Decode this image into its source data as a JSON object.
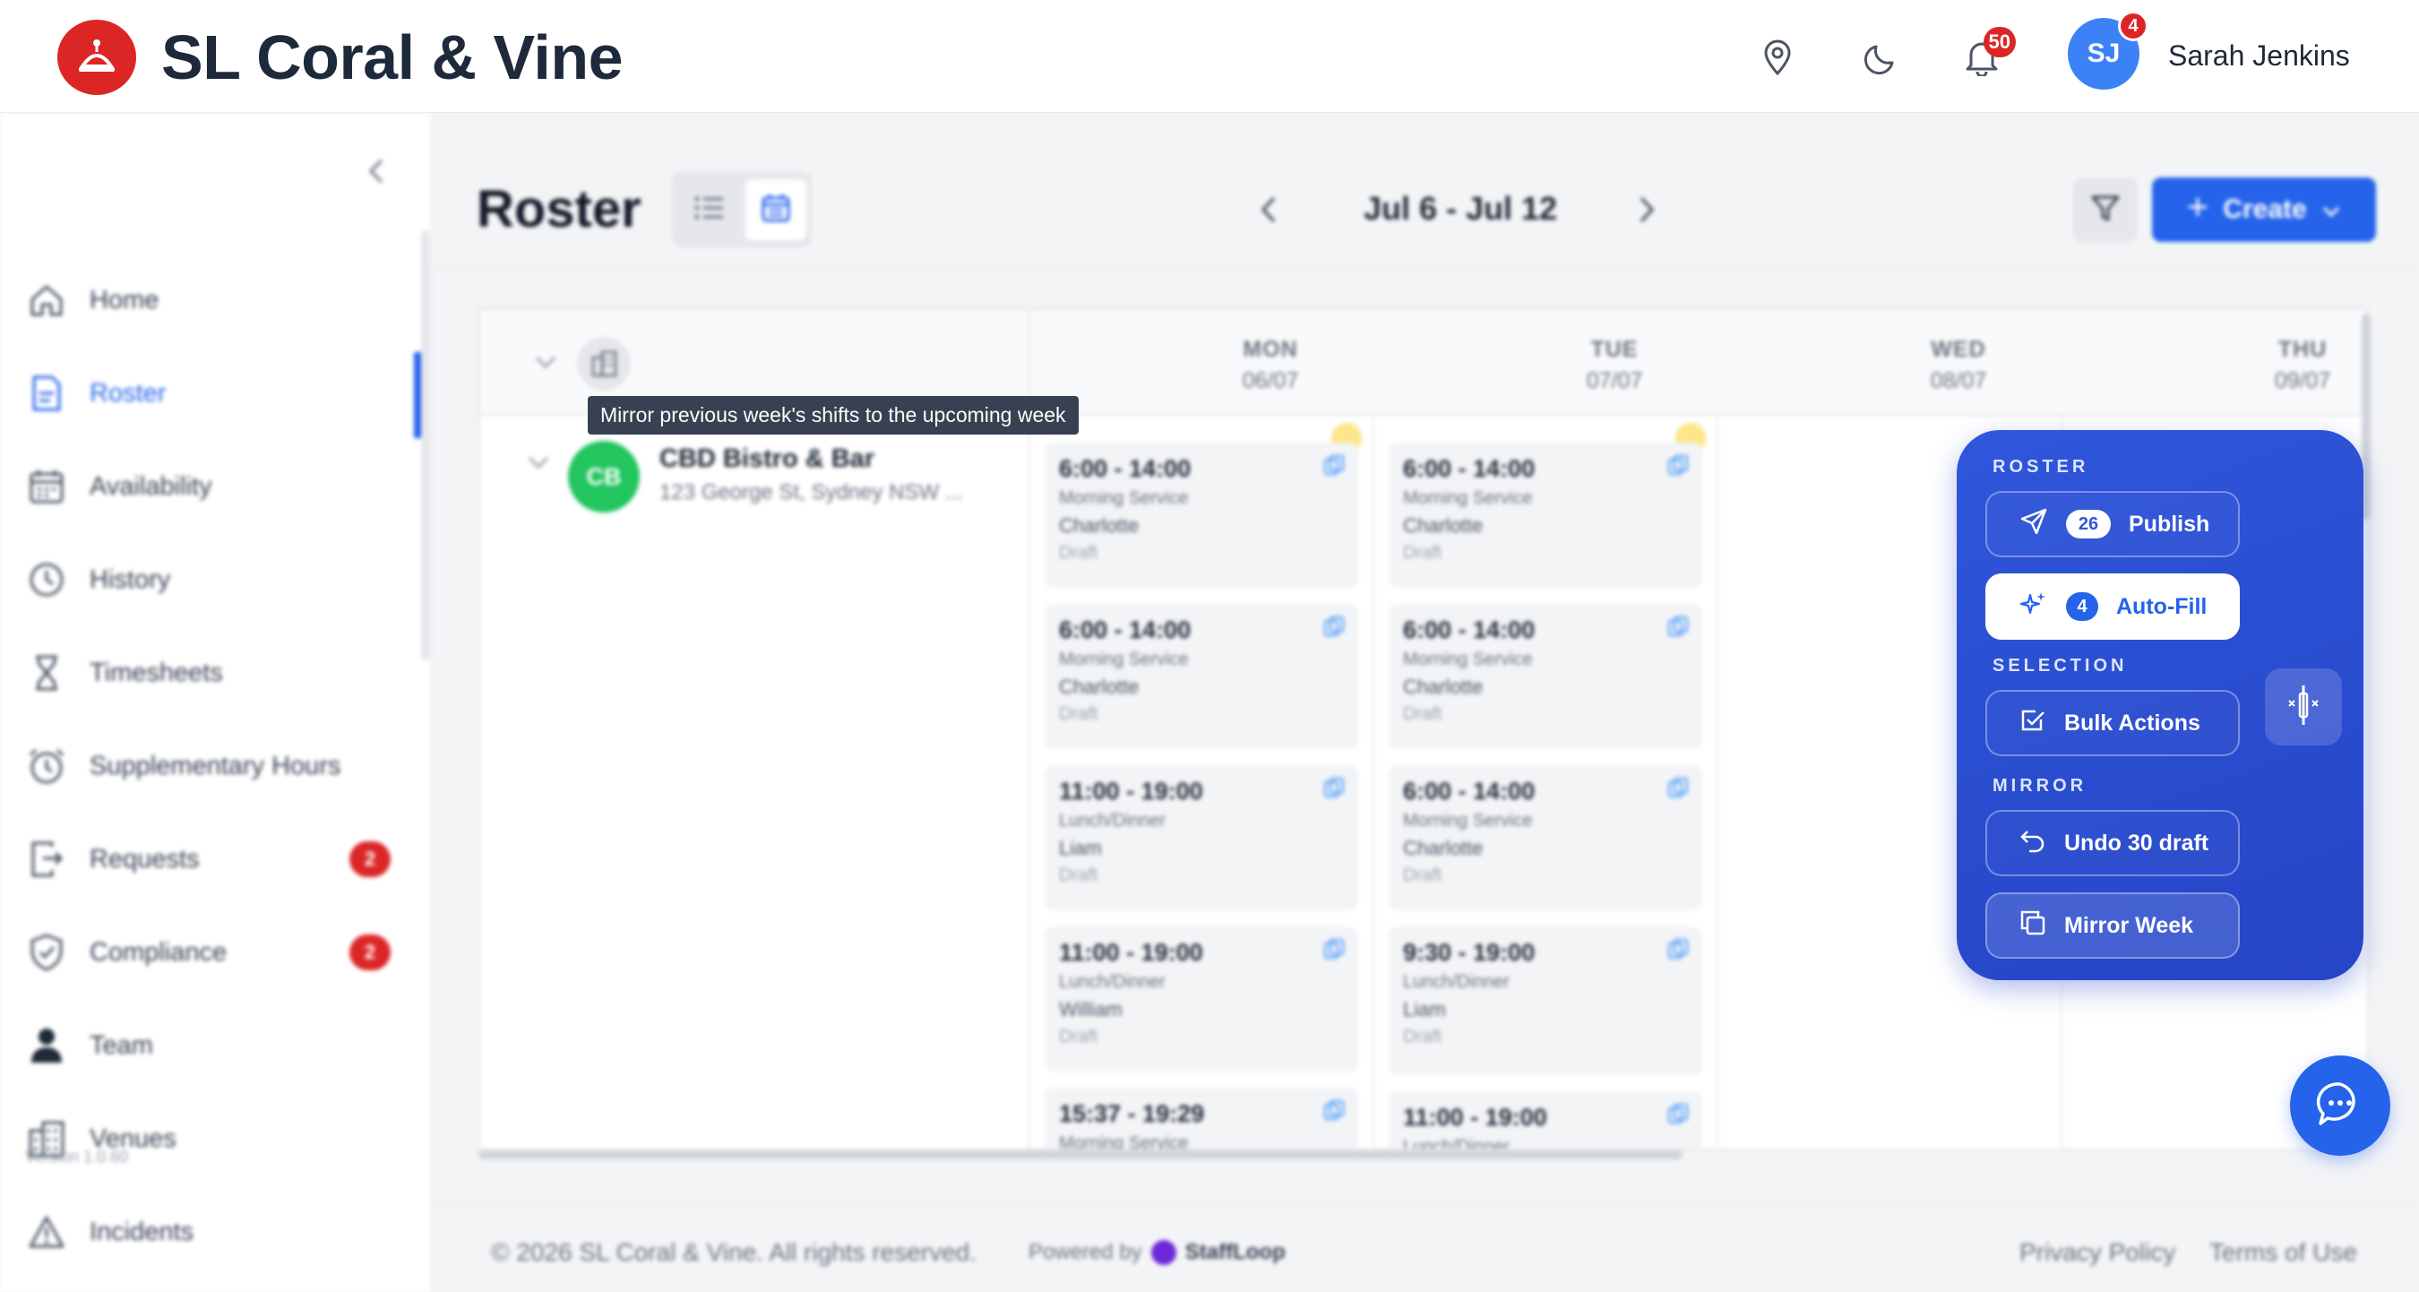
{
  "header": {
    "brand": "SL Coral & Vine",
    "notifications_count": "50",
    "avatar_initials": "SJ",
    "avatar_badge": "4",
    "user_name": "Sarah Jenkins"
  },
  "sidebar": {
    "items": [
      {
        "label": "Home",
        "icon": "home-icon"
      },
      {
        "label": "Roster",
        "icon": "roster-icon",
        "active": true
      },
      {
        "label": "Availability",
        "icon": "calendar-icon"
      },
      {
        "label": "History",
        "icon": "clock-icon"
      },
      {
        "label": "Timesheets",
        "icon": "hourglass-icon"
      },
      {
        "label": "Supplementary Hours",
        "icon": "alarm-icon"
      },
      {
        "label": "Requests",
        "icon": "request-icon",
        "badge": "2"
      },
      {
        "label": "Compliance",
        "icon": "shield-icon",
        "badge": "2"
      },
      {
        "label": "Team",
        "icon": "person-icon"
      },
      {
        "label": "Venues",
        "icon": "building-icon"
      },
      {
        "label": "Incidents",
        "icon": "warning-icon"
      }
    ],
    "version": "Version 1.0.60"
  },
  "toolbar": {
    "title": "Roster",
    "week_range": "Jul 6 - Jul 12",
    "create_label": "Create"
  },
  "grid": {
    "days": [
      {
        "name": "MON",
        "date": "06/07"
      },
      {
        "name": "TUE",
        "date": "07/07"
      },
      {
        "name": "WED",
        "date": "08/07"
      },
      {
        "name": "THU",
        "date": "09/07"
      }
    ],
    "venue": {
      "initials": "CB",
      "name": "CBD Bistro & Bar",
      "address": "123 George St, Sydney NSW ..."
    },
    "mon_shifts": [
      {
        "time": "6:00 - 14:00",
        "service": "Morning Service",
        "staff": "Charlotte",
        "status": "Draft"
      },
      {
        "time": "6:00 - 14:00",
        "service": "Morning Service",
        "staff": "Charlotte",
        "status": "Draft"
      },
      {
        "time": "11:00 - 19:00",
        "service": "Lunch/Dinner",
        "staff": "Liam",
        "status": "Draft"
      },
      {
        "time": "11:00 - 19:00",
        "service": "Lunch/Dinner",
        "staff": "William",
        "status": "Draft"
      },
      {
        "time": "15:37 - 19:29",
        "service": "Morning Service",
        "staff": "",
        "status": ""
      }
    ],
    "tue_shifts": [
      {
        "time": "6:00 - 14:00",
        "service": "Morning Service",
        "staff": "Charlotte",
        "status": "Draft"
      },
      {
        "time": "6:00 - 14:00",
        "service": "Morning Service",
        "staff": "Charlotte",
        "status": "Draft"
      },
      {
        "time": "6:00 - 14:00",
        "service": "Morning Service",
        "staff": "Charlotte",
        "status": "Draft"
      },
      {
        "time": "9:30 - 19:00",
        "service": "Lunch/Dinner",
        "staff": "Liam",
        "status": "Draft"
      },
      {
        "time": "11:00 - 19:00",
        "service": "Lunch/Dinner",
        "staff": "",
        "status": ""
      }
    ]
  },
  "tooltip": "Mirror previous week's shifts to the upcoming week",
  "panel": {
    "roster_label": "ROSTER",
    "publish_label": "Publish",
    "publish_count": "26",
    "autofill_label": "Auto-Fill",
    "autofill_count": "4",
    "selection_label": "SELECTION",
    "bulk_label": "Bulk Actions",
    "mirror_label": "MIRROR",
    "undo_label": "Undo 30 draft",
    "mirror_week_label": "Mirror Week"
  },
  "footer": {
    "copyright": "© 2026 SL Coral & Vine. All rights reserved.",
    "powered_by": "Powered by",
    "powered_brand": "StaffLoop",
    "privacy": "Privacy Policy",
    "terms": "Terms of Use"
  },
  "colors": {
    "brand_red": "#dc2626",
    "primary_blue": "#2563eb",
    "panel_blue": "#2f56db",
    "venue_green": "#22c55e"
  }
}
